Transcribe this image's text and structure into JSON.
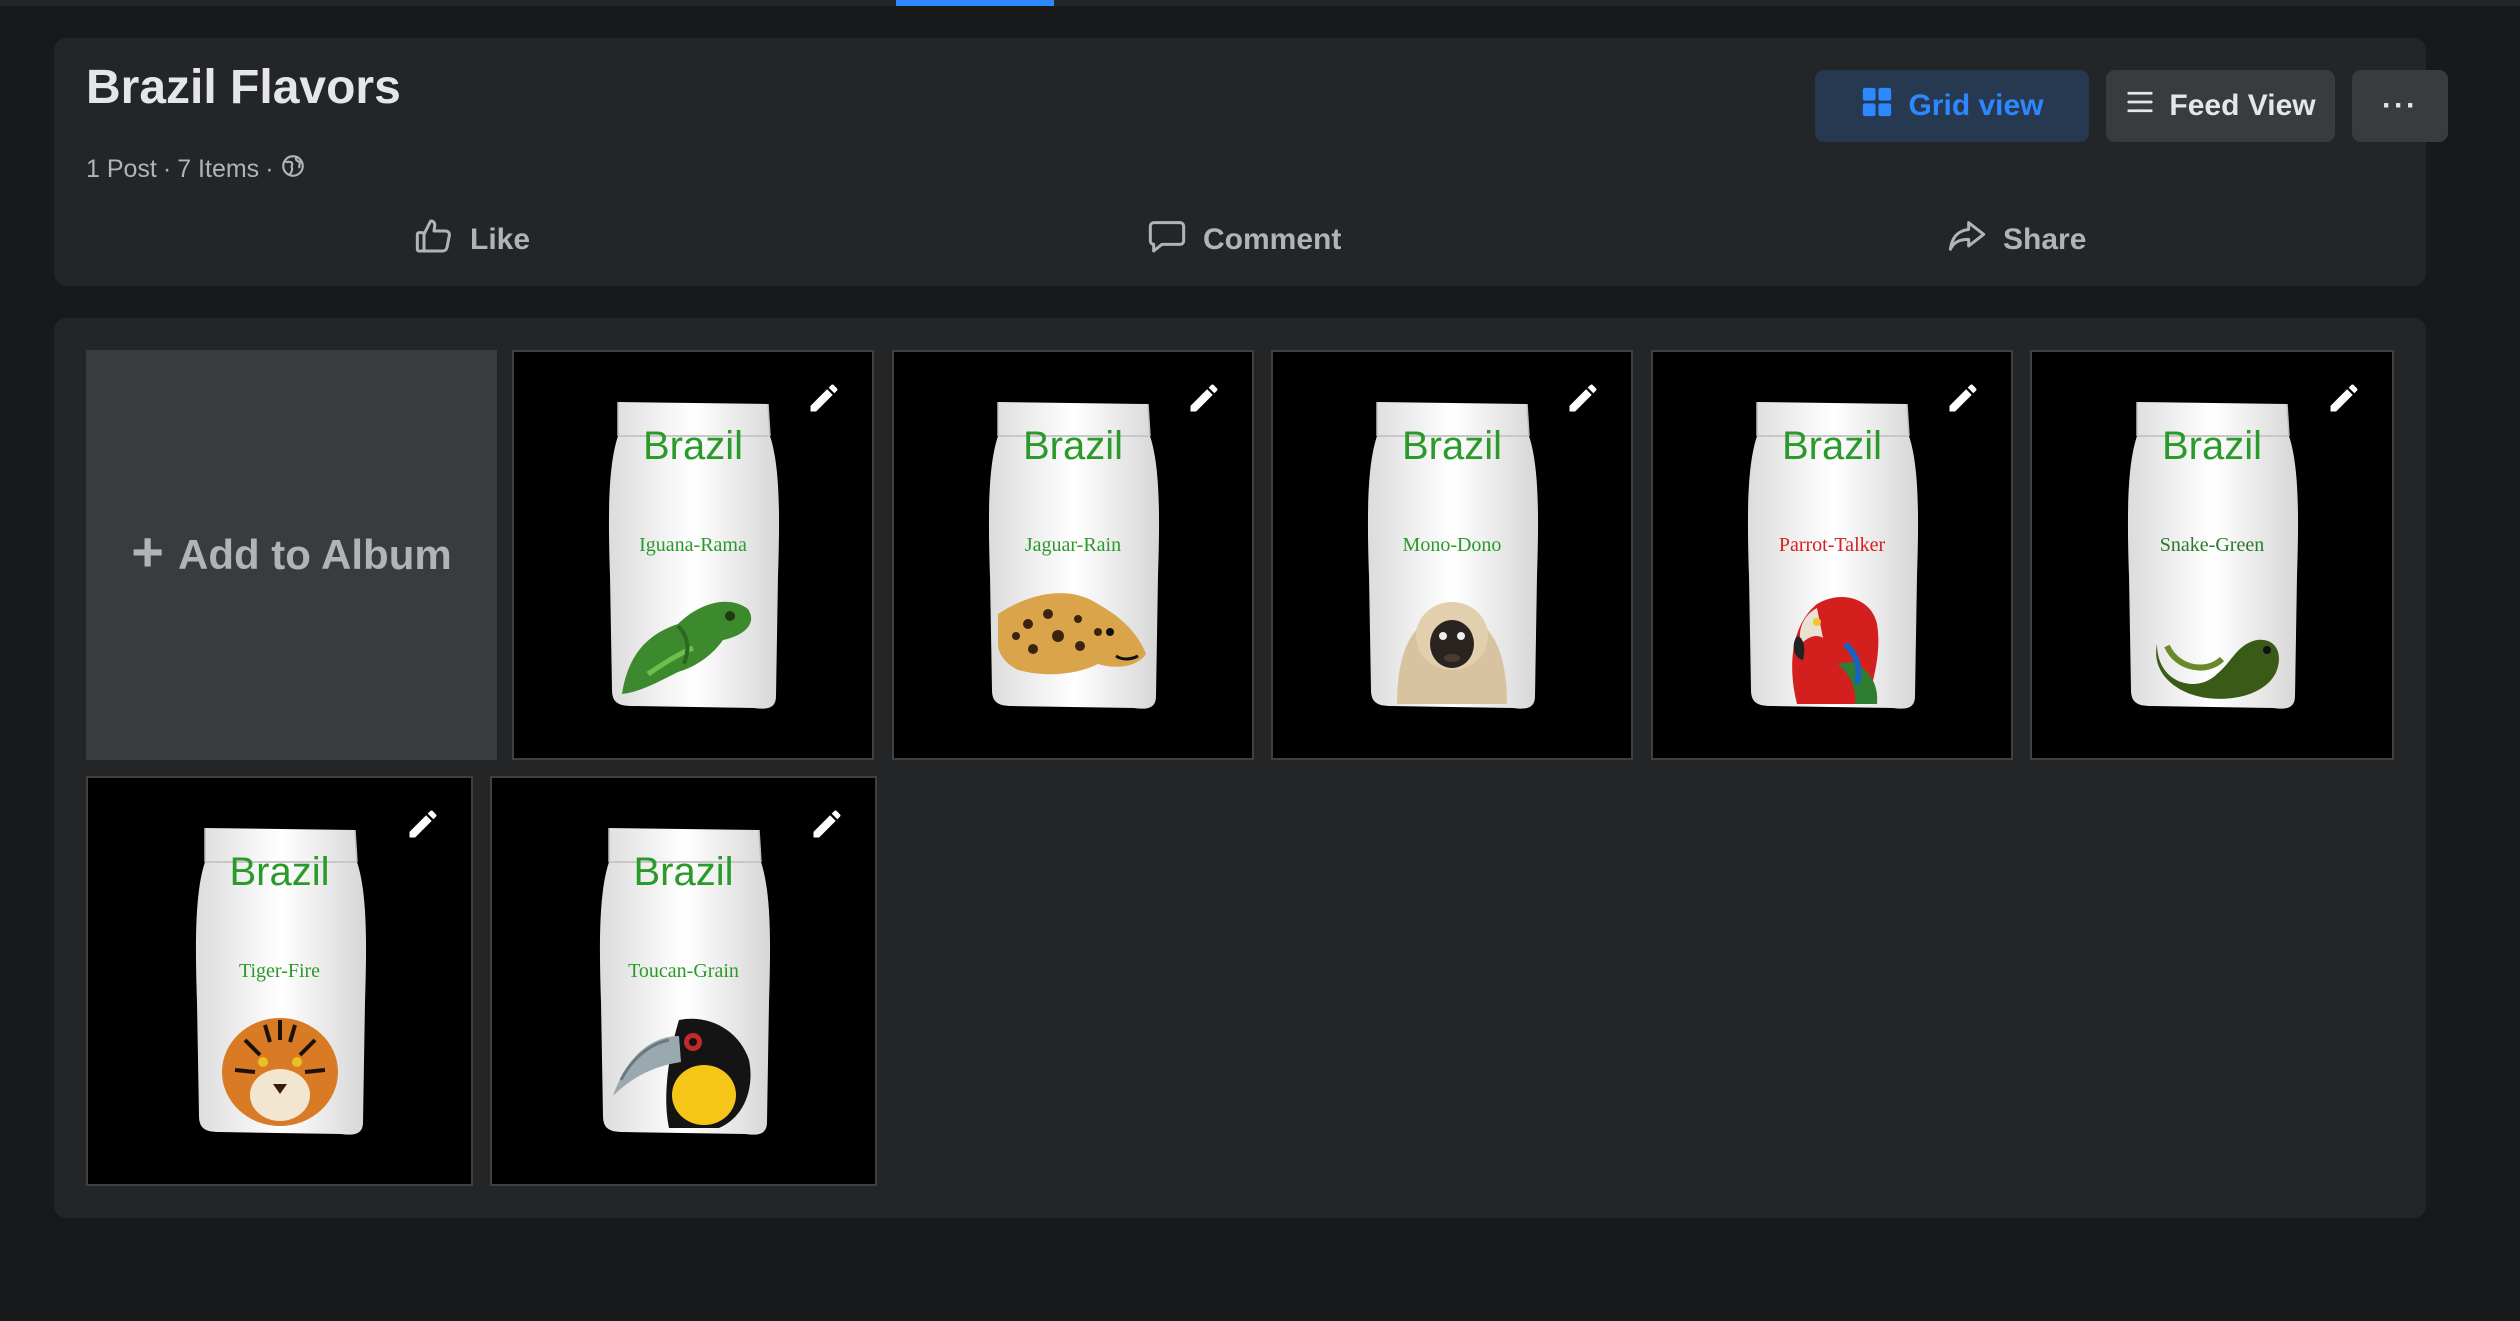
{
  "album": {
    "title": "Brazil Flavors",
    "posts": "1 Post",
    "items": "7 Items",
    "privacy_icon": "globe-icon"
  },
  "view_controls": {
    "grid_label": "Grid view",
    "feed_label": "Feed View",
    "more_label": "···"
  },
  "actions": {
    "like": "Like",
    "comment": "Comment",
    "share": "Share"
  },
  "add_tile": {
    "label": "Add to Album"
  },
  "photos": [
    {
      "brand": "Brazil",
      "flavor": "Iguana-Rama",
      "flavor_color": "#2a9a2a",
      "animal": "iguana"
    },
    {
      "brand": "Brazil",
      "flavor": "Jaguar-Rain",
      "flavor_color": "#2a9a2a",
      "animal": "jaguar"
    },
    {
      "brand": "Brazil",
      "flavor": "Mono-Dono",
      "flavor_color": "#2a9a2a",
      "animal": "monkey"
    },
    {
      "brand": "Brazil",
      "flavor": "Parrot-Talker",
      "flavor_color": "#d42020",
      "animal": "parrot"
    },
    {
      "brand": "Brazil",
      "flavor": "Snake-Green",
      "flavor_color": "#2a7a2a",
      "animal": "snake"
    },
    {
      "brand": "Brazil",
      "flavor": "Tiger-Fire",
      "flavor_color": "#2a9a2a",
      "animal": "tiger"
    },
    {
      "brand": "Brazil",
      "flavor": "Toucan-Grain",
      "flavor_color": "#2a9a2a",
      "animal": "toucan"
    }
  ],
  "colors": {
    "accent": "#2d88ff",
    "background": "#18191a",
    "card": "#242526"
  }
}
